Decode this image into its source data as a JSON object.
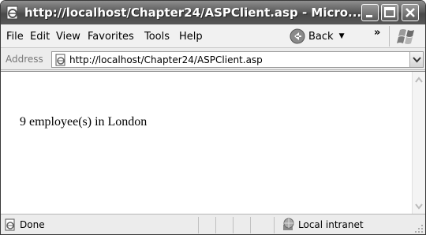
{
  "window": {
    "title": "http://localhost/Chapter24/ASPClient.asp - Micro..."
  },
  "menu": {
    "items": [
      {
        "label": "File",
        "name": "file"
      },
      {
        "label": "Edit",
        "name": "edit"
      },
      {
        "label": "View",
        "name": "view"
      },
      {
        "label": "Favorites",
        "name": "favorites"
      },
      {
        "label": "Tools",
        "name": "tools"
      },
      {
        "label": "Help",
        "name": "help"
      }
    ],
    "back_label": "Back",
    "more_glyph": "»"
  },
  "address": {
    "label": "Address",
    "url": "http://localhost/Chapter24/ASPClient.asp"
  },
  "content": {
    "text": "9 employee(s) in London"
  },
  "status": {
    "text": "Done",
    "zone": "Local intranet"
  },
  "icons": {
    "page": "ie-page-icon",
    "back": "back-arrow-icon",
    "windows_logo": "windows-flag-icon",
    "zone": "intranet-globe-icon"
  }
}
